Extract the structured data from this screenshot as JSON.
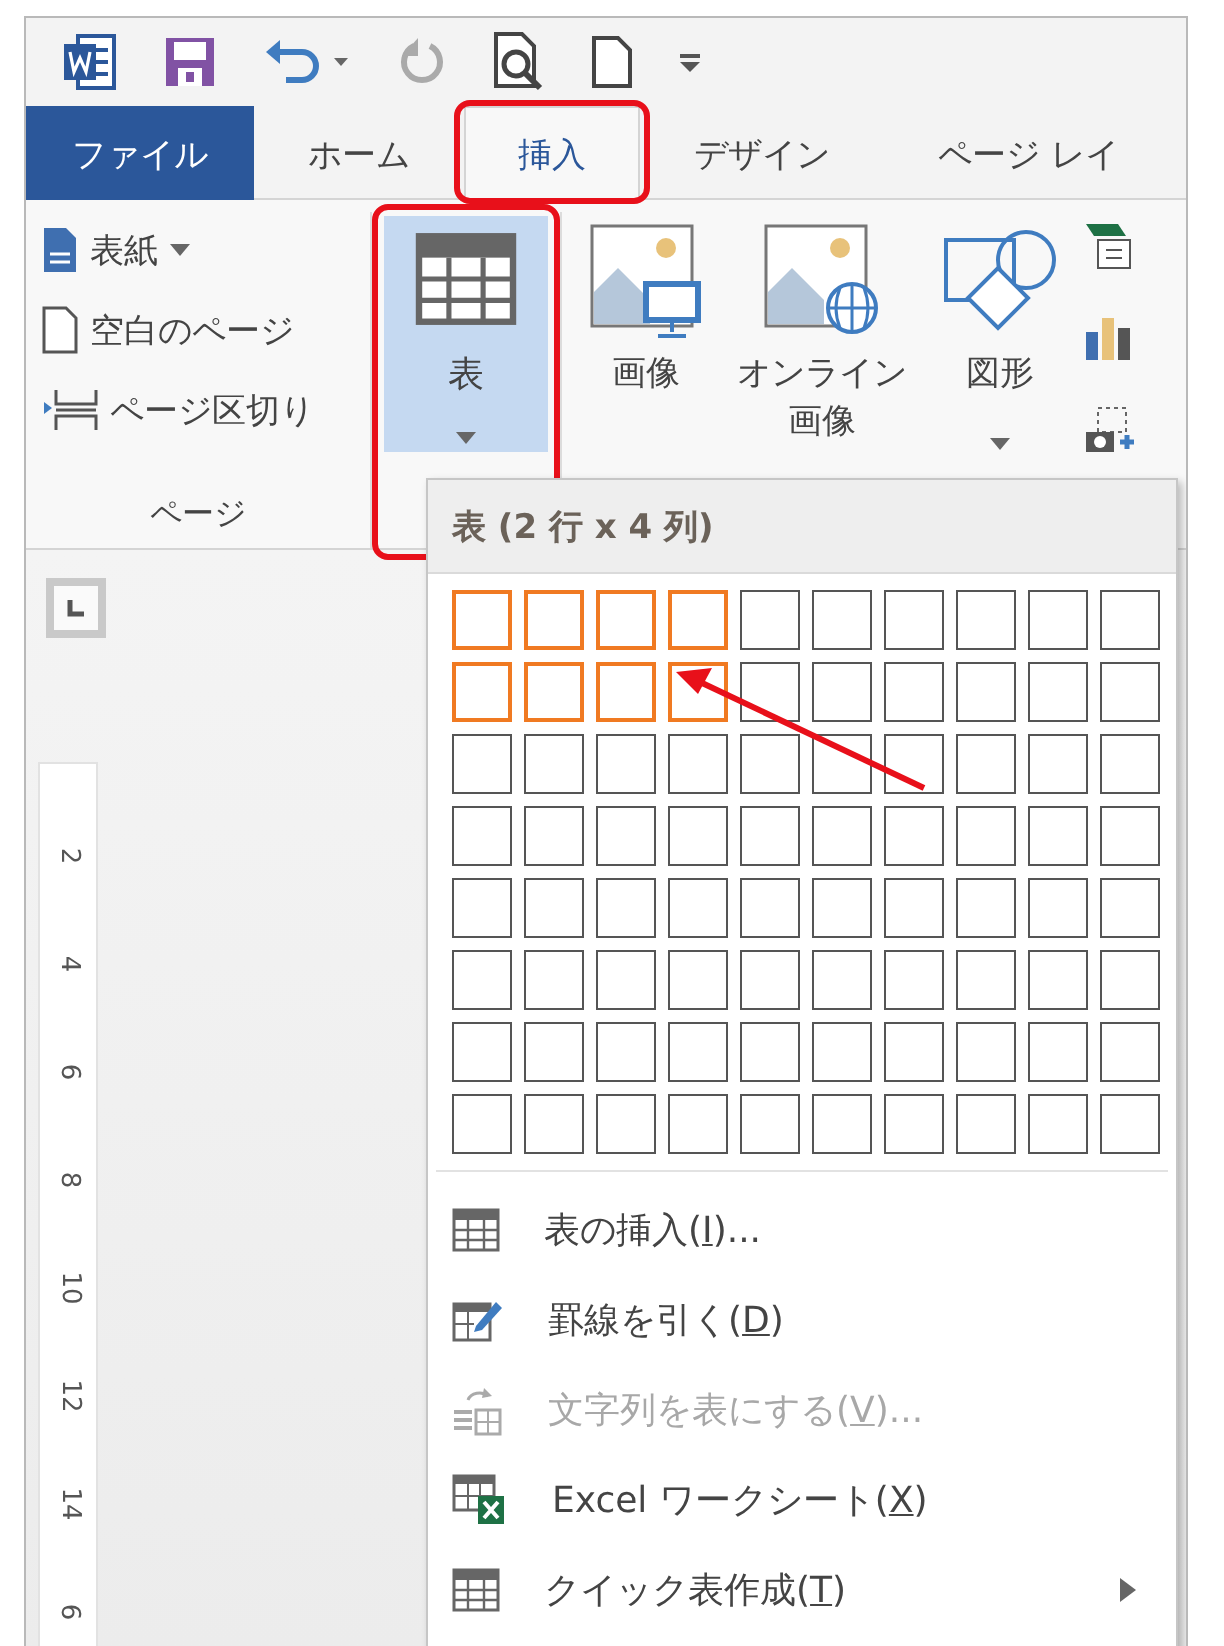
{
  "quick_access": {
    "redo": {
      "disabled": true
    }
  },
  "tabs": [
    {
      "label": "ファイル",
      "kind": "file",
      "selected": false,
      "annotated": false
    },
    {
      "label": "ホーム",
      "kind": "tab",
      "selected": false,
      "annotated": false
    },
    {
      "label": "挿入",
      "kind": "tab",
      "selected": true,
      "annotated": true
    },
    {
      "label": "デザイン",
      "kind": "tab",
      "selected": false,
      "annotated": false
    },
    {
      "label": "ページ レイ",
      "kind": "tab",
      "selected": false,
      "annotated": false
    }
  ],
  "ribbon": {
    "page_group": {
      "label": "ページ",
      "items": [
        {
          "label": "表紙",
          "kind": "cover",
          "dropdown": true
        },
        {
          "label": "空白のページ",
          "kind": "blank",
          "dropdown": false
        },
        {
          "label": "ページ区切り",
          "kind": "break",
          "dropdown": false
        }
      ]
    },
    "table_button": {
      "label": "表",
      "pressed": true,
      "annotated": true
    },
    "illustrations": [
      {
        "label": "画像",
        "kind": "picture",
        "dropdown": false
      },
      {
        "label": "オンライン画像",
        "kind": "online",
        "dropdown": false
      },
      {
        "label": "図形",
        "kind": "shapes",
        "dropdown": true
      }
    ]
  },
  "ruler": {
    "labels": [
      "2",
      "4",
      "6",
      "8",
      "10",
      "12",
      "14",
      "6"
    ]
  },
  "menu": {
    "title": "表 (2 行 x 4 列)",
    "grid": [
      [
        {
          "selected": true
        },
        {
          "selected": true
        },
        {
          "selected": true
        },
        {
          "selected": true
        },
        {
          "selected": false
        },
        {
          "selected": false
        },
        {
          "selected": false
        },
        {
          "selected": false
        },
        {
          "selected": false
        },
        {
          "selected": false
        }
      ],
      [
        {
          "selected": true
        },
        {
          "selected": true
        },
        {
          "selected": true
        },
        {
          "selected": true
        },
        {
          "selected": false
        },
        {
          "selected": false
        },
        {
          "selected": false
        },
        {
          "selected": false
        },
        {
          "selected": false
        },
        {
          "selected": false
        }
      ],
      [
        {
          "selected": false
        },
        {
          "selected": false
        },
        {
          "selected": false
        },
        {
          "selected": false
        },
        {
          "selected": false
        },
        {
          "selected": false
        },
        {
          "selected": false
        },
        {
          "selected": false
        },
        {
          "selected": false
        },
        {
          "selected": false
        }
      ],
      [
        {
          "selected": false
        },
        {
          "selected": false
        },
        {
          "selected": false
        },
        {
          "selected": false
        },
        {
          "selected": false
        },
        {
          "selected": false
        },
        {
          "selected": false
        },
        {
          "selected": false
        },
        {
          "selected": false
        },
        {
          "selected": false
        }
      ],
      [
        {
          "selected": false
        },
        {
          "selected": false
        },
        {
          "selected": false
        },
        {
          "selected": false
        },
        {
          "selected": false
        },
        {
          "selected": false
        },
        {
          "selected": false
        },
        {
          "selected": false
        },
        {
          "selected": false
        },
        {
          "selected": false
        }
      ],
      [
        {
          "selected": false
        },
        {
          "selected": false
        },
        {
          "selected": false
        },
        {
          "selected": false
        },
        {
          "selected": false
        },
        {
          "selected": false
        },
        {
          "selected": false
        },
        {
          "selected": false
        },
        {
          "selected": false
        },
        {
          "selected": false
        }
      ],
      [
        {
          "selected": false
        },
        {
          "selected": false
        },
        {
          "selected": false
        },
        {
          "selected": false
        },
        {
          "selected": false
        },
        {
          "selected": false
        },
        {
          "selected": false
        },
        {
          "selected": false
        },
        {
          "selected": false
        },
        {
          "selected": false
        }
      ],
      [
        {
          "selected": false
        },
        {
          "selected": false
        },
        {
          "selected": false
        },
        {
          "selected": false
        },
        {
          "selected": false
        },
        {
          "selected": false
        },
        {
          "selected": false
        },
        {
          "selected": false
        },
        {
          "selected": false
        },
        {
          "selected": false
        }
      ]
    ],
    "items": [
      {
        "kind": "table",
        "before": "表の挿入(",
        "key": "I",
        "after": ")...",
        "disabled": false,
        "submenu": false
      },
      {
        "kind": "draw",
        "before": "罫線を引く(",
        "key": "D",
        "after": ")",
        "disabled": false,
        "submenu": false
      },
      {
        "kind": "convert",
        "before": "文字列を表にする(",
        "key": "V",
        "after": ")...",
        "disabled": true,
        "submenu": false
      },
      {
        "kind": "excel",
        "before": "Excel ワークシート(",
        "key": "X",
        "after": ")",
        "disabled": false,
        "submenu": false
      },
      {
        "kind": "table",
        "before": "クイック表作成(",
        "key": "T",
        "after": ")",
        "disabled": false,
        "submenu": true
      }
    ]
  }
}
